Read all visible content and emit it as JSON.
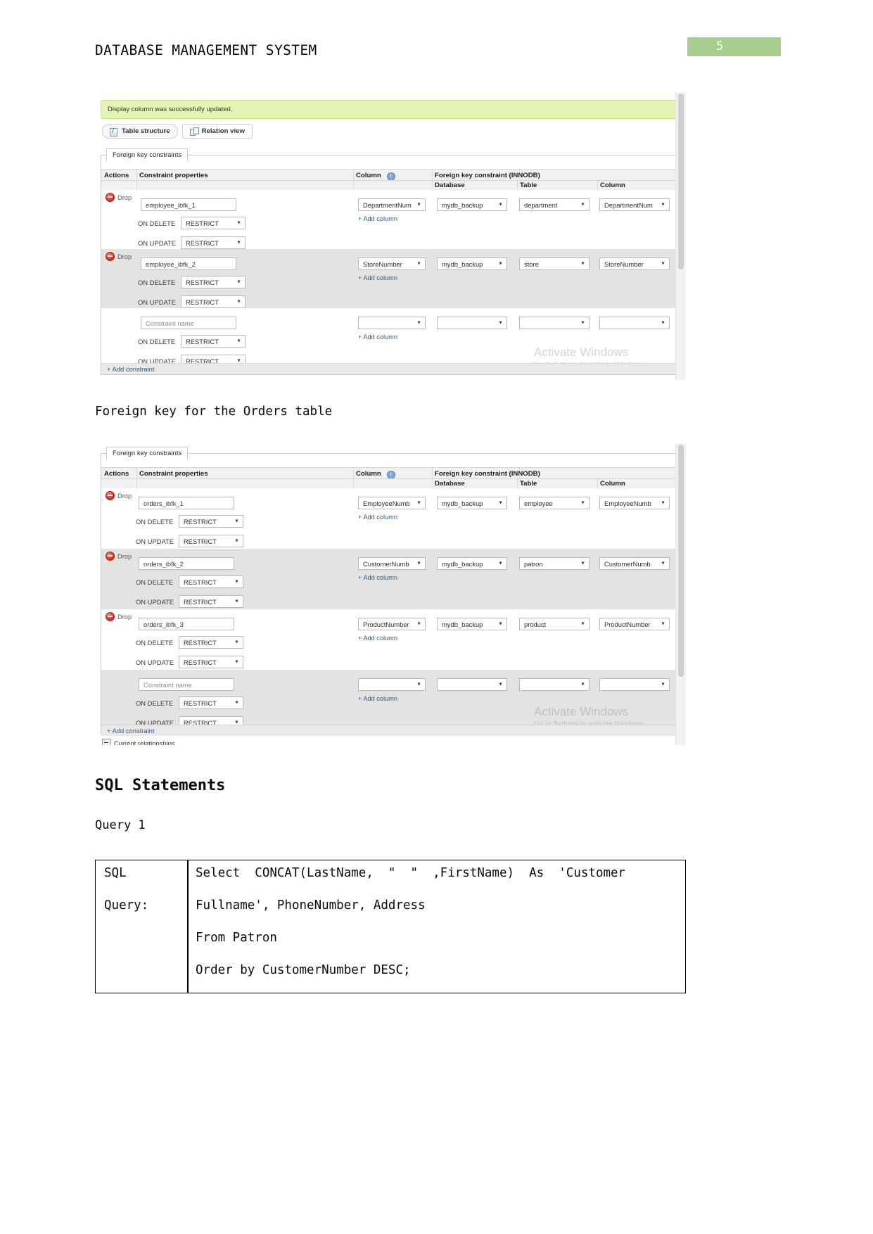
{
  "document": {
    "header_title": "DATABASE MANAGEMENT SYSTEM",
    "page_number": "5",
    "page_badge_color": "#a6cf8f",
    "caption_orders": "Foreign key for the Orders table",
    "heading_sql": "SQL Statements",
    "subheading_query": "Query 1"
  },
  "screenshot1": {
    "notice": "Display column was successfully updated.",
    "tabs": [
      {
        "label": "Table structure",
        "icon": "table-structure-icon",
        "active": true
      },
      {
        "label": "Relation view",
        "icon": "relation-view-icon",
        "active": false
      }
    ],
    "legend": "Foreign key constraints",
    "headers": {
      "actions": "Actions",
      "constraint_properties": "Constraint properties",
      "column": "Column",
      "column_info_icon": "info-icon",
      "fk_constraint": "Foreign key constraint (INNODB)",
      "database": "Database",
      "table": "Table",
      "fk_column": "Column"
    },
    "drop_label": "Drop",
    "add_column_label": "+ Add column",
    "add_constraint_label": "+ Add constraint",
    "on_delete_label": "ON DELETE",
    "on_update_label": "ON UPDATE",
    "constraint_name_placeholder": "Constraint name",
    "rows": [
      {
        "name": "employee_ibfk_1",
        "on_delete": "RESTRICT",
        "on_update": "RESTRICT",
        "column": "DepartmentNum",
        "database": "mydb_backup",
        "table": "department",
        "fk_column": "DepartmentNum",
        "has_drop": true
      },
      {
        "name": "employee_ibfk_2",
        "on_delete": "RESTRICT",
        "on_update": "RESTRICT",
        "column": "StoreNumber",
        "database": "mydb_backup",
        "table": "store",
        "fk_column": "StoreNumber",
        "has_drop": true
      },
      {
        "name": "",
        "on_delete": "RESTRICT",
        "on_update": "RESTRICT",
        "column": "",
        "database": "",
        "table": "",
        "fk_column": "",
        "has_drop": false
      }
    ],
    "watermark_line1": "Activate Windows",
    "watermark_line2": "Go to Settings to activate Windows."
  },
  "screenshot2": {
    "legend": "Foreign key constraints",
    "headers": {
      "actions": "Actions",
      "constraint_properties": "Constraint properties",
      "column": "Column",
      "column_info_icon": "info-icon",
      "fk_constraint": "Foreign key constraint (INNODB)",
      "database": "Database",
      "table": "Table",
      "fk_column": "Column"
    },
    "drop_label": "Drop",
    "add_column_label": "+ Add column",
    "add_constraint_label": "+ Add constraint",
    "on_delete_label": "ON DELETE",
    "on_update_label": "ON UPDATE",
    "constraint_name_placeholder": "Constraint name",
    "relationships_label": "Current relationships",
    "rows": [
      {
        "name": "orders_ibfk_1",
        "on_delete": "RESTRICT",
        "on_update": "RESTRICT",
        "column": "EmployeeNumb",
        "database": "mydb_backup",
        "table": "employee",
        "fk_column": "EmployeeNumb",
        "has_drop": true
      },
      {
        "name": "orders_ibfk_2",
        "on_delete": "RESTRICT",
        "on_update": "RESTRICT",
        "column": "CustomerNumb",
        "database": "mydb_backup",
        "table": "patron",
        "fk_column": "CustomerNumb",
        "has_drop": true
      },
      {
        "name": "orders_ibfk_3",
        "on_delete": "RESTRICT",
        "on_update": "RESTRICT",
        "column": "ProductNumber",
        "database": "mydb_backup",
        "table": "product",
        "fk_column": "ProductNumber",
        "has_drop": true
      },
      {
        "name": "",
        "on_delete": "RESTRICT",
        "on_update": "RESTRICT",
        "column": "",
        "database": "",
        "table": "",
        "fk_column": "",
        "has_drop": false
      }
    ],
    "watermark_line1": "Activate Windows",
    "watermark_line2": "Go to Settings to activate Windows."
  },
  "sql_table": {
    "label_line1": "SQL",
    "label_line2": "Query:",
    "query_lines": [
      "Select  CONCAT(LastName,  \"  \"  ,FirstName)  As  'Customer",
      "Fullname', PhoneNumber, Address",
      "From Patron",
      "Order by CustomerNumber DESC;"
    ]
  }
}
